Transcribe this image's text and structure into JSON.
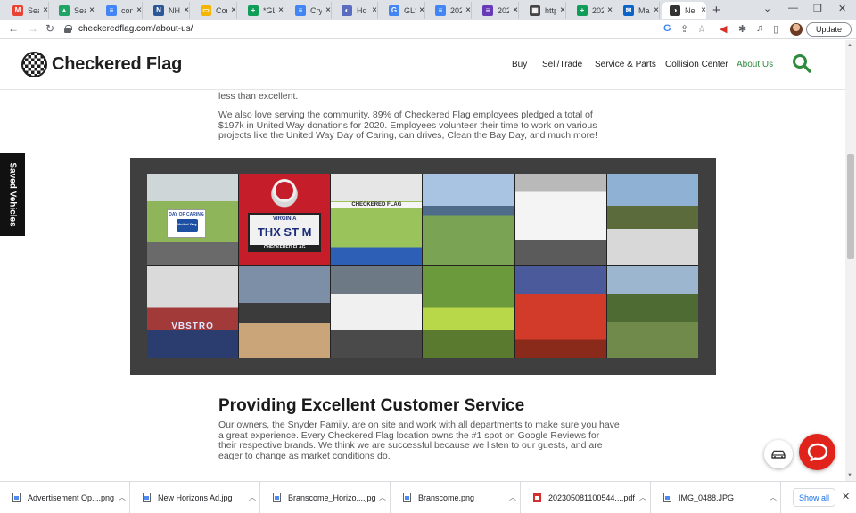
{
  "browser": {
    "tabs": [
      {
        "label": "Sea",
        "favicon": "gmail-icon",
        "color": "#ea4335",
        "glyph": "M"
      },
      {
        "label": "Sea",
        "favicon": "drive-icon",
        "color": "#1fa463",
        "glyph": "▲"
      },
      {
        "label": "con",
        "favicon": "docs-icon",
        "color": "#4285f4",
        "glyph": "≡"
      },
      {
        "label": "NH",
        "favicon": "site-icon",
        "color": "#2b5797",
        "glyph": "N"
      },
      {
        "label": "Cor",
        "favicon": "slides-icon",
        "color": "#f4b400",
        "glyph": "▭"
      },
      {
        "label": "*GL",
        "favicon": "sheets-icon",
        "color": "#0f9d58",
        "glyph": "+"
      },
      {
        "label": "Cry",
        "favicon": "docs-icon",
        "color": "#4285f4",
        "glyph": "≡"
      },
      {
        "label": "Ho",
        "favicon": "site-icon",
        "color": "#5b6bc0",
        "glyph": "◐"
      },
      {
        "label": "GLS",
        "favicon": "google-icon",
        "color": "#4285f4",
        "glyph": "G"
      },
      {
        "label": "202",
        "favicon": "docs-icon",
        "color": "#4285f4",
        "glyph": "≡"
      },
      {
        "label": "202",
        "favicon": "forms-icon",
        "color": "#673ab7",
        "glyph": "≡"
      },
      {
        "label": "http",
        "favicon": "site-icon",
        "color": "#444444",
        "glyph": "▦"
      },
      {
        "label": "202",
        "favicon": "sheets-icon",
        "color": "#0f9d58",
        "glyph": "+"
      },
      {
        "label": "Ma",
        "favicon": "outlook-icon",
        "color": "#0a64c8",
        "glyph": "✉"
      },
      {
        "label": "Ne",
        "favicon": "site-icon",
        "color": "#333333",
        "glyph": "◑",
        "active": true
      }
    ],
    "new_tab": "+",
    "url": "checkeredflag.com/about-us/",
    "update_label": "Update"
  },
  "site": {
    "logo_text": "Checkered Flag",
    "nav": [
      "Buy",
      "Sell/Trade",
      "Service & Parts",
      "Collision Center",
      "About Us"
    ],
    "active_nav": "About Us",
    "accent_color": "#2e8b3d"
  },
  "content": {
    "cutoff_text": "their area of expertise. We employ the best of the best to make sure your visit with us is nothing less than excellent.",
    "community_text": "We also love serving the community. 89% of Checkered Flag employees pledged a total of $197k in United Way donations for 2020. Employees volunteer their time to work on various projects like the United Way Day of Caring, can drives, Clean the Bay Day, and much more!",
    "gallery_captions": {
      "day_of_caring": "DAY OF CARING",
      "united_way": "United Way",
      "plate_state": "VIRGINIA",
      "plate": "THX ST M",
      "plate_frame": "CHECKERED FLAG",
      "banner": "CHECKERED FLAG",
      "wall_text": "VBSTRO"
    },
    "heading": "Providing Excellent Customer Service",
    "service_text": "Our owners, the Snyder Family, are on site and work with all departments to make sure you have a great experience. Every Checkered Flag location owns the #1 spot on Google Reviews for their respective brands. We think we are successful because we listen to our guests, and are eager to change as market conditions do."
  },
  "side_tab": "Saved Vehicles",
  "downloads": {
    "items": [
      {
        "name": "Advertisement Op....png",
        "type": "image"
      },
      {
        "name": "New Horizons Ad.jpg",
        "type": "image"
      },
      {
        "name": "Branscome_Horizo....jpg",
        "type": "image"
      },
      {
        "name": "Branscome.png",
        "type": "image"
      },
      {
        "name": "202305081100544....pdf",
        "type": "pdf"
      },
      {
        "name": "IMG_0488.JPG",
        "type": "image"
      }
    ],
    "show_all": "Show all"
  }
}
